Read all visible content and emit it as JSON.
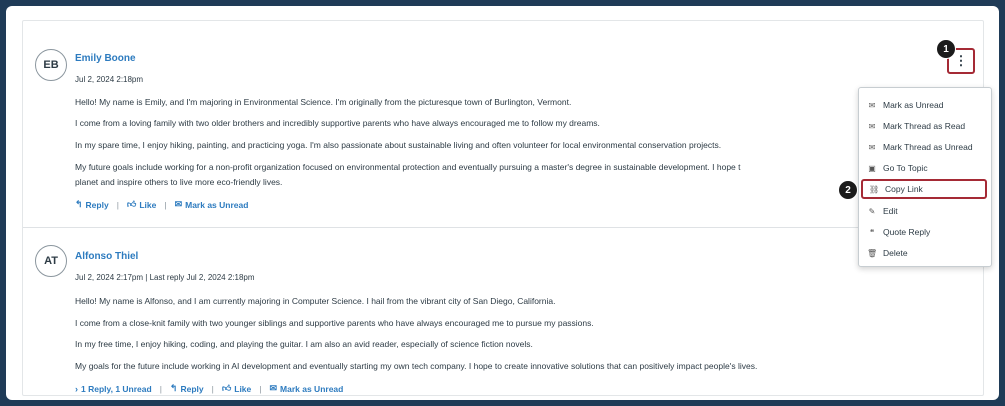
{
  "posts": [
    {
      "initials": "EB",
      "author": "Emily Boone",
      "meta": "Jul 2, 2024 2:18pm",
      "lines": [
        "Hello! My name is Emily, and I'm majoring in Environmental Science. I'm originally from the picturesque town of Burlington, Vermont.",
        "I come from a loving family with two older brothers and incredibly supportive parents who have always encouraged me to follow my dreams.",
        "In my spare time, I enjoy hiking, painting, and practicing yoga. I'm also passionate about sustainable living and often volunteer for local environmental conservation projects.",
        "My future goals include working for a non-profit organization focused on environmental protection and eventually pursuing a master's degree in sustainable development. I hope t",
        "planet and inspire others to live more eco-friendly lives."
      ],
      "actions": {
        "reply": "Reply",
        "like": "Like",
        "mark_unread": "Mark as Unread"
      }
    },
    {
      "initials": "AT",
      "author": "Alfonso Thiel",
      "meta": "Jul 2, 2024 2:17pm | Last reply Jul 2, 2024 2:18pm",
      "lines": [
        "Hello! My name is Alfonso, and I am currently majoring in Computer Science. I hail from the vibrant city of San Diego, California.",
        "I come from a close-knit family with two younger siblings and supportive parents who have always encouraged me to pursue my passions.",
        "In my free time, I enjoy hiking, coding, and playing the guitar. I am also an avid reader, especially of science fiction novels.",
        "My goals for the future include working in AI development and eventually starting my own tech company. I hope to create innovative solutions that can positively impact people's lives."
      ],
      "actions": {
        "replies": "1 Reply, 1 Unread",
        "reply": "Reply",
        "like": "Like",
        "mark_unread": "Mark as Unread"
      }
    }
  ],
  "menu": {
    "items": [
      "Mark as Unread",
      "Mark Thread as Read",
      "Mark Thread as Unread",
      "Go To Topic",
      "Copy Link",
      "Edit",
      "Quote Reply",
      "Delete"
    ]
  },
  "callouts": [
    "1",
    "2"
  ],
  "kebab_glyph": "⋮",
  "colors": {
    "link": "#2d7bbf",
    "highlight": "#a52a35",
    "frame": "#1f3b57"
  }
}
